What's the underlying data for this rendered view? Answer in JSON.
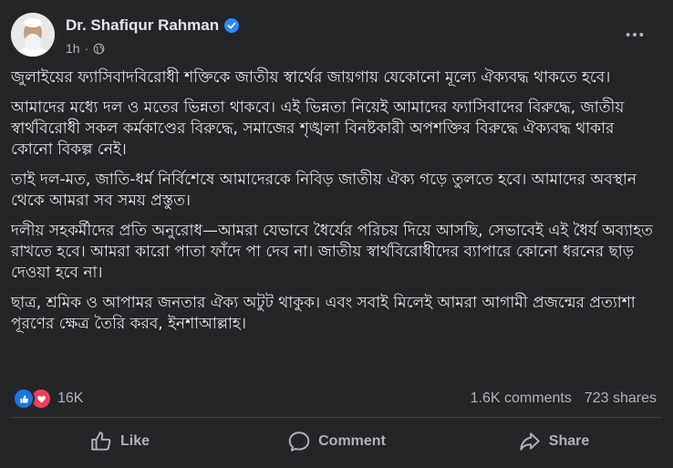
{
  "post": {
    "author": "Dr. Shafiqur Rahman",
    "time": "1h",
    "paragraphs": [
      "জুলাইয়ের ফ্যাসিবাদবিরোধী শক্তিকে জাতীয় স্বার্থের জায়গায় যেকোনো মূল্যে ঐক্যবদ্ধ থাকতে হবে।",
      "আমাদের মধ্যে দল ও মতের ভিন্নতা থাকবে। এই ভিন্নতা নিয়েই আমাদের ফ্যাসিবাদের বিরুদ্ধে, জাতীয় স্বার্থবিরোধী সকল কর্মকাণ্ডের বিরুদ্ধে, সমাজের শৃঙ্খলা বিনষ্টকারী অপশক্তির বিরুদ্ধে ঐক্যবদ্ধ থাকার কোনো বিকল্প নেই।",
      "তাই দল-মত, জাতি-ধর্ম নির্বিশেষে আমাদেরকে নিবিড় জাতীয় ঐক্য গড়ে তুলতে হবে। আমাদের অবস্থান থেকে আমরা সব সময় প্রস্তুত।",
      "দলীয় সহকর্মীদের প্রতি অনুরোধ—আমরা যেভাবে ধৈর্যের পরিচয় দিয়ে আসছি, সেভাবেই এই ধৈর্য অব্যাহত রাখতে হবে। আমরা কারো পাতা ফাঁদে পা দেব না। জাতীয় স্বার্থবিরোধীদের ব্যাপারে কোনো ধরনের ছাড় দেওয়া হবে না।",
      "ছাত্র, শ্রমিক ও আপামর জনতার ঐক্য অটুট থাকুক। এবং সবাই মিলেই আমরা আগামী প্রজন্মের প্রত্যাশা পূরণের ক্ষেত্র তৈরি করব, ইনশাআল্লাহ।"
    ]
  },
  "engagement": {
    "reaction_count": "16K",
    "comments": "1.6K comments",
    "shares": "723 shares"
  },
  "actions": {
    "like": "Like",
    "comment": "Comment",
    "share": "Share"
  },
  "icons": [
    "verified-icon",
    "globe-icon",
    "more-icon",
    "like-reaction-icon",
    "love-reaction-icon",
    "like-icon",
    "comment-icon",
    "share-icon"
  ],
  "colors": {
    "background": "#242526",
    "text": "#e4e6eb",
    "secondary": "#b0b3b8",
    "accent": "#2d88ff"
  }
}
